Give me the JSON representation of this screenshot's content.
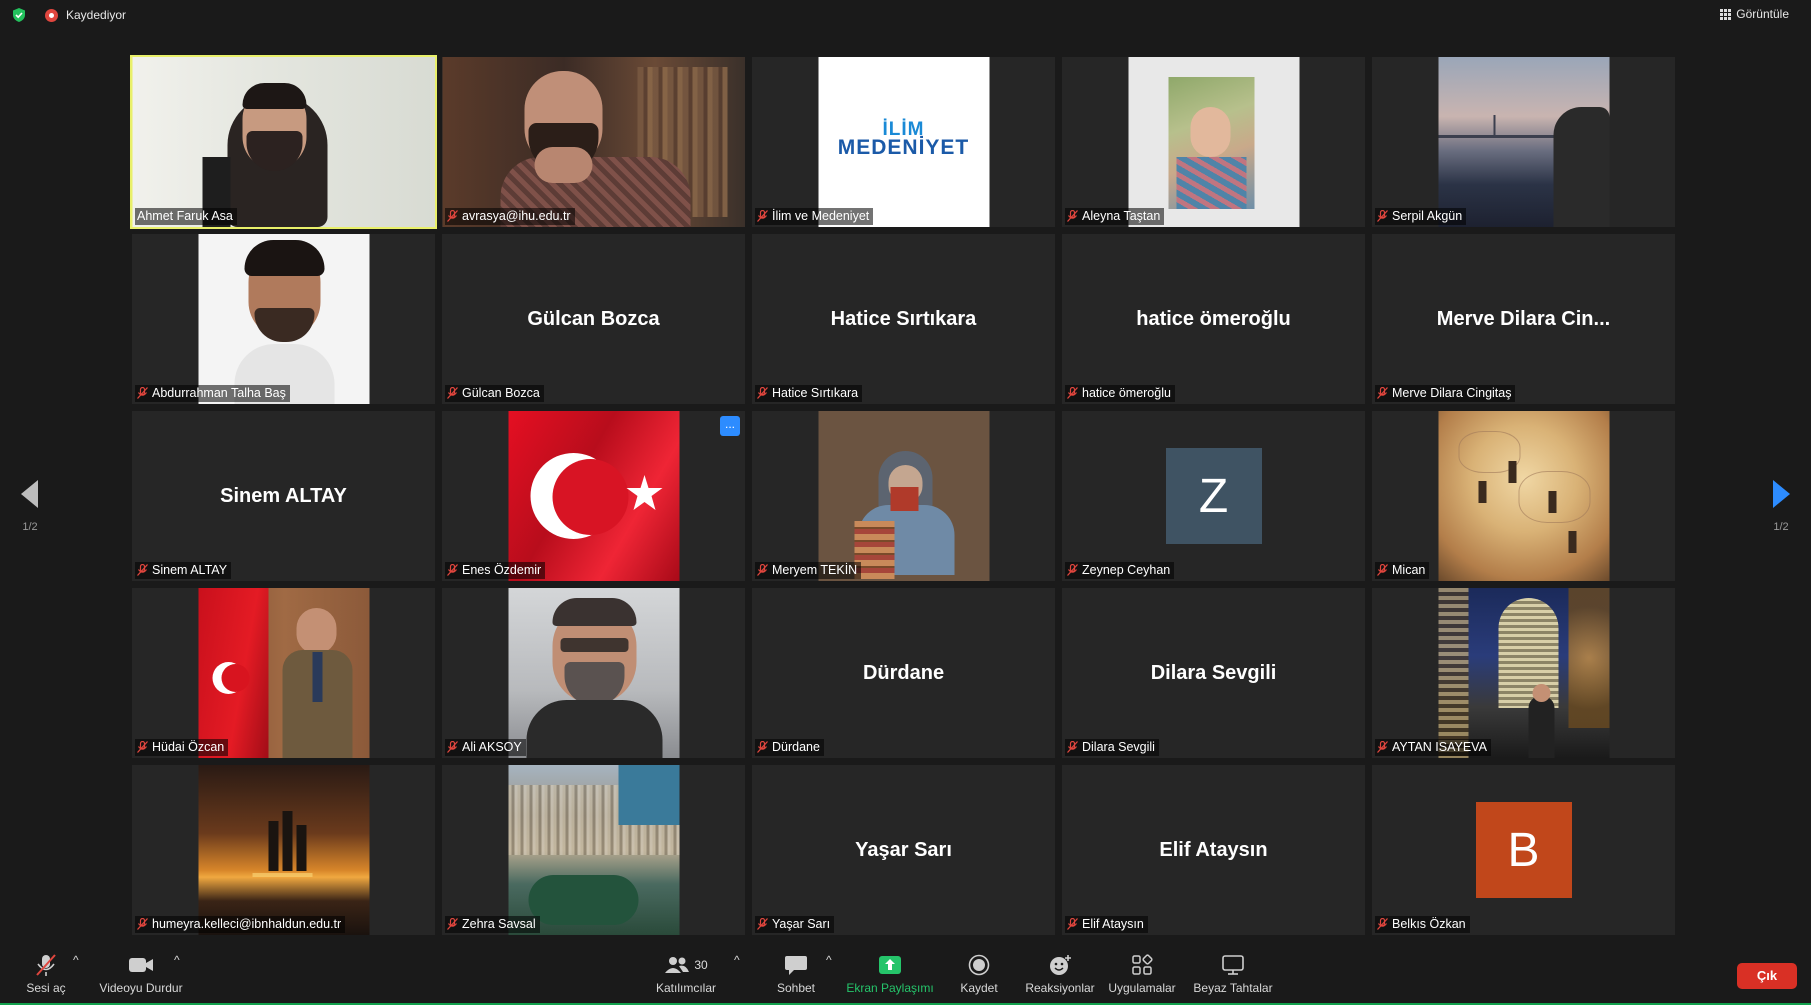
{
  "topbar": {
    "recording_label": "Kaydediyor",
    "view_label": "Görüntüle"
  },
  "navigation": {
    "page_indicator": "1/2"
  },
  "participants": [
    {
      "label": "Ahmet Faruk Asa",
      "type": "video",
      "active": true
    },
    {
      "label": "avrasya@ihu.edu.tr",
      "type": "video"
    },
    {
      "label": "İlim ve Medeniyet",
      "type": "logo",
      "logo_line1": "İLİM",
      "logo_line2": "MEDENİYET"
    },
    {
      "label": "Aleyna Taştan",
      "type": "photo"
    },
    {
      "label": "Serpil Akgün",
      "type": "photo"
    },
    {
      "label": "Abdurrahman Talha Baş",
      "type": "photo"
    },
    {
      "label": "Gülcan Bozca",
      "type": "name",
      "display_name": "Gülcan Bozca"
    },
    {
      "label": "Hatice Sırtıkara",
      "type": "name",
      "display_name": "Hatice Sırtıkara"
    },
    {
      "label": "hatice ömeroğlu",
      "type": "name",
      "display_name": "hatice ömeroğlu"
    },
    {
      "label": "Merve Dilara Cingitaş",
      "type": "name",
      "display_name": "Merve Dilara Cin..."
    },
    {
      "label": "Sinem ALTAY",
      "type": "name",
      "display_name": "Sinem ALTAY"
    },
    {
      "label": "Enes Özdemir",
      "type": "photo",
      "more_button": "..."
    },
    {
      "label": "Meryem TEKİN",
      "type": "photo"
    },
    {
      "label": "Zeynep Ceyhan",
      "type": "avatar",
      "initial": "Z",
      "avatar_color": "#3f5363"
    },
    {
      "label": "Mican",
      "type": "photo"
    },
    {
      "label": "Hüdai Özcan",
      "type": "photo"
    },
    {
      "label": "Ali AKSOY",
      "type": "photo"
    },
    {
      "label": "Dürdane",
      "type": "name",
      "display_name": "Dürdane"
    },
    {
      "label": "Dilara Sevgili",
      "type": "name",
      "display_name": "Dilara Sevgili"
    },
    {
      "label": "AYTAN ISAYEVA",
      "type": "photo"
    },
    {
      "label": "humeyra.kelleci@ibnhaldun.edu.tr",
      "type": "photo"
    },
    {
      "label": "Zehra Savsal",
      "type": "photo"
    },
    {
      "label": "Yaşar Sarı",
      "type": "name",
      "display_name": "Yaşar Sarı"
    },
    {
      "label": "Elif Ataysın",
      "type": "name",
      "display_name": "Elif Ataysın"
    },
    {
      "label": "Belkıs Özkan",
      "type": "avatar",
      "initial": "B",
      "avatar_color": "#c1471b"
    }
  ],
  "toolbar": {
    "unmute": "Sesi aç",
    "stop_video": "Videoyu Durdur",
    "participants": "Katılımcılar",
    "participants_count": "30",
    "chat": "Sohbet",
    "share_screen": "Ekran Paylaşımı",
    "record": "Kaydet",
    "reactions": "Reaksiyonlar",
    "apps": "Uygulamalar",
    "whiteboard": "Beyaz Tahtalar",
    "exit": "Çık"
  },
  "colors": {
    "active_speaker": "#e9f06a",
    "share_green": "#25c46a",
    "exit_red": "#d93025",
    "accent_blue": "#2d8cff"
  }
}
